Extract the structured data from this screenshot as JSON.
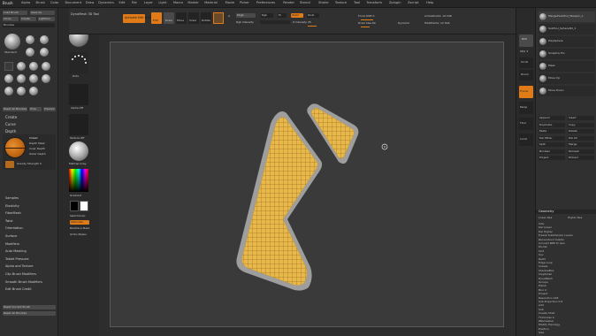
{
  "app": {
    "palette_title": "Brush"
  },
  "menu": {
    "items": [
      "Alpha",
      "Brush",
      "Color",
      "Document",
      "Draw",
      "Dynamics",
      "Edit",
      "File",
      "Layer",
      "Light",
      "Macro",
      "Marker",
      "Material",
      "Movie",
      "Picker",
      "Preferences",
      "Render",
      "Stencil",
      "Stroke",
      "Texture",
      "Tool",
      "Transform",
      "Zplugin",
      "Zscript",
      "Help"
    ]
  },
  "left_panel": {
    "top_buttons": [
      "Load Brush",
      "Save As",
      "Clone",
      "Create",
      "Lightbox",
      "Brushes"
    ],
    "brush_label": "Standard",
    "row_labels": [
      "Move",
      "Clay",
      "ClayBuildup",
      "DamStandard",
      "hPolish",
      "Inflate",
      "Pinch",
      "TrimDynamic"
    ],
    "reset_buttons": [
      "Reset All Brushes",
      "Hide",
      "Preview"
    ],
    "sections": [
      "Create",
      "Curve",
      "Depth"
    ],
    "depth_items": [
      "Imbed",
      "Depth Mask",
      "Inner Depth",
      "Outer Depth",
      "Gravity Strength 0"
    ],
    "sub_sections": [
      "Samples",
      "Elasticity",
      "FiberMesh",
      "Twist",
      "Orientation",
      "Surface",
      "Modifiers",
      "Auto Masking",
      "Tablet Pressure",
      "Alpha and Texture",
      "Clip Brush Modifiers",
      "Smooth Brush Modifiers",
      "Edit Brush Credit"
    ],
    "bottom_buttons": [
      "Reset Current Brush",
      "Reset All Brushes"
    ]
  },
  "shelf": {
    "items": [
      "Standard",
      "Dots",
      "Alpha Off",
      "Texture Off",
      "MatCap Gray"
    ],
    "labels": [
      "Gradient",
      "SwitchColor",
      "Alternate",
      "Backface Mask",
      "Ortho Masks"
    ]
  },
  "topbar": {
    "brush_label": "Activate Edit Mode",
    "dyna": "DynaMesh 3D Tool",
    "buttons": [
      "Edit",
      "Draw",
      "Move",
      "Scale",
      "Rotate"
    ],
    "mrgb": "Mrgb",
    "rgb": "Rgb",
    "m": "M",
    "zadd": "Zadd",
    "zsub": "Zsub",
    "rgb_intensity": "Rgb Intensity",
    "z_intensity": "Z Intensity 25",
    "focal": "Focal Shift 0",
    "draw_size": "Draw Size 64",
    "dynamic": "Dynamic",
    "active_points": "ActivePoints: 12.546",
    "total_points": "TotalPoints: 12.546"
  },
  "right_shelf": {
    "buttons": [
      "BPR",
      "SPix 3",
      "Scroll",
      "Zoom",
      "Actual",
      "AAHalf",
      "Persp",
      "Floor",
      "Local",
      "Frame",
      "Move",
      "Scale",
      "Rotate",
      "PolyF",
      "Transp",
      "Ghost",
      "Solo",
      "Xpose"
    ]
  },
  "right_panel": {
    "subtools": [
      "MergedSubTool_Weapon_1",
      "SubTool_Sphere3D_1",
      "PolySphere",
      "Sculptris Pro",
      "Mask",
      "Move Up",
      "Move Down"
    ],
    "groups": [
      "Append",
      "Insert",
      "Duplicate",
      "Copy",
      "Paste",
      "Delete",
      "Del Other",
      "Del All",
      "Split",
      "Merge",
      "Boolean",
      "Remesh",
      "Project",
      "Extract"
    ],
    "geometry": "Geometry",
    "geometry_items": [
      "Lower Res",
      "Higher Res",
      "Sdiv",
      "Del Lower",
      "Del Higher",
      "Freeze SubDivision Levels",
      "Reconstruct Subdiv",
      "Convert BPR To Geo",
      "Divide",
      "Smt",
      "Suv",
      "ReUV",
      "Edge Loop",
      "Crease",
      "ShadowBox",
      "ClayPolish",
      "DynaMesh",
      "Groups",
      "Polish",
      "Blur 2",
      "Project",
      "Resolution 128",
      "Sub Projection 0.6",
      "Add",
      "Sub",
      "Create Shell",
      "Thickness 4",
      "ZRemesher",
      "Modify Topology",
      "Position",
      "Size",
      "MeshIntegrity"
    ]
  },
  "colors": {
    "accent": "#e07b18",
    "panel": "#303030",
    "canvas": "#3a3a3a",
    "mesh_fill": "#e8b84a",
    "mesh_rim": "#9e9e9e"
  }
}
